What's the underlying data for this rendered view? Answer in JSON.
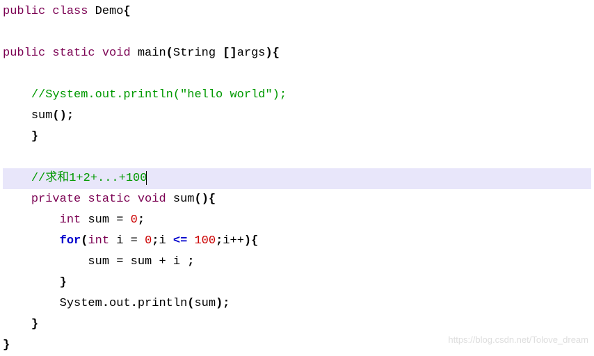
{
  "code": {
    "l1": {
      "kw1": "public",
      "kw2": "class",
      "cls": "Demo",
      "brace": "{"
    },
    "l2": "",
    "l3": {
      "kw1": "public",
      "kw2": "static",
      "kw3": "void",
      "fn": "main",
      "lp": "(",
      "type": "String",
      "arr": " []",
      "arg": "args",
      "rp": ")",
      "brace": "{"
    },
    "l4": "",
    "l5": {
      "comment": "//System.out.println(\"hello world\");"
    },
    "l6": {
      "call": "sum",
      "lp": "(",
      "rp": ")",
      "semi": ";"
    },
    "l7": {
      "brace": "}"
    },
    "l8": "",
    "l9": {
      "comment": "//求和1+2+...+100"
    },
    "l10": {
      "kw1": "private",
      "kw2": "static",
      "kw3": "void",
      "fn": "sum",
      "lp": "(",
      "rp": ")",
      "brace": "{"
    },
    "l11": {
      "type": "int",
      "var": "sum",
      "eq": "=",
      "num": "0",
      "semi": ";"
    },
    "l12": {
      "kw": "for",
      "lp": "(",
      "type": "int",
      "var": "i",
      "eq": "=",
      "num1": "0",
      "semi1": ";",
      "var2": "i",
      "op": "<=",
      "num2": "100",
      "semi2": ";",
      "var3": "i",
      "inc": "++",
      "rp": ")",
      "brace": "{"
    },
    "l13": {
      "var1": "sum",
      "eq": "=",
      "var2": "sum",
      "plus": "+",
      "var3": "i",
      "semi": ";"
    },
    "l14": {
      "brace": "}"
    },
    "l15": {
      "obj": "System",
      "dot1": ".",
      "field": "out",
      "dot2": ".",
      "method": "println",
      "lp": "(",
      "arg": "sum",
      "rp": ")",
      "semi": ";"
    },
    "l16": {
      "brace": "}"
    },
    "l17": {
      "brace": "}"
    }
  },
  "watermark": "https://blog.csdn.net/Tolove_dream"
}
